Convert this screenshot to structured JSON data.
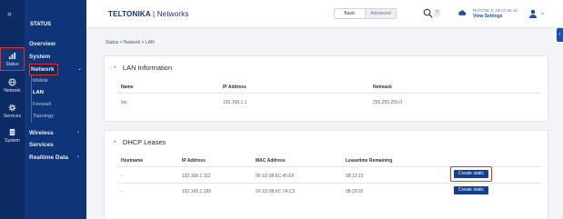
{
  "rail": {
    "collapse_icon": "double-chevron-left-icon",
    "items": [
      {
        "label": "Status",
        "icon": "chart-icon"
      },
      {
        "label": "Network",
        "icon": "globe-icon"
      },
      {
        "label": "Services",
        "icon": "gear-icon"
      },
      {
        "label": "System",
        "icon": "document-icon"
      }
    ]
  },
  "menu": {
    "heading": "STATUS",
    "items": [
      "Overview",
      "System",
      "Network",
      "Wireless",
      "Services",
      "Realtime Data"
    ],
    "submenu": [
      "Mobile",
      "LAN",
      "Firewall",
      "Topology"
    ]
  },
  "header": {
    "brand": "TELTONIKA",
    "separator": "|",
    "product": "Networks",
    "mode_basic": "Basic",
    "mode_advanced": "Advanced",
    "help_glyph": "?",
    "device_name": "RUTCIM_8_00.07.06.10",
    "view_settings": "View Settings"
  },
  "breadcrumb": "Status > Network > LAN",
  "lan_info": {
    "title": "LAN Information",
    "columns": [
      "Name",
      "IP Address",
      "Netmask"
    ],
    "rows": [
      [
        "lan",
        "192.168.1.1",
        "255.255.255.0"
      ]
    ]
  },
  "dhcp": {
    "title": "DHCP Leases",
    "columns": [
      "Hostname",
      "IP Address",
      "MAC Address",
      "Leasetime Remaining"
    ],
    "rows": [
      [
        "-",
        "192.168.1.112",
        "00:1D:08:6C:45:EF",
        "08:13:10"
      ],
      [
        "-",
        "192.168.1.189",
        "00:1D:08:6C:7A:C3",
        "08:29:02"
      ]
    ],
    "action_label": "Create static"
  },
  "colors": {
    "rail_bg": "#0c2a63",
    "menu_bg": "#0f3478",
    "accent": "#163f8f",
    "highlight": "#d9342b"
  }
}
